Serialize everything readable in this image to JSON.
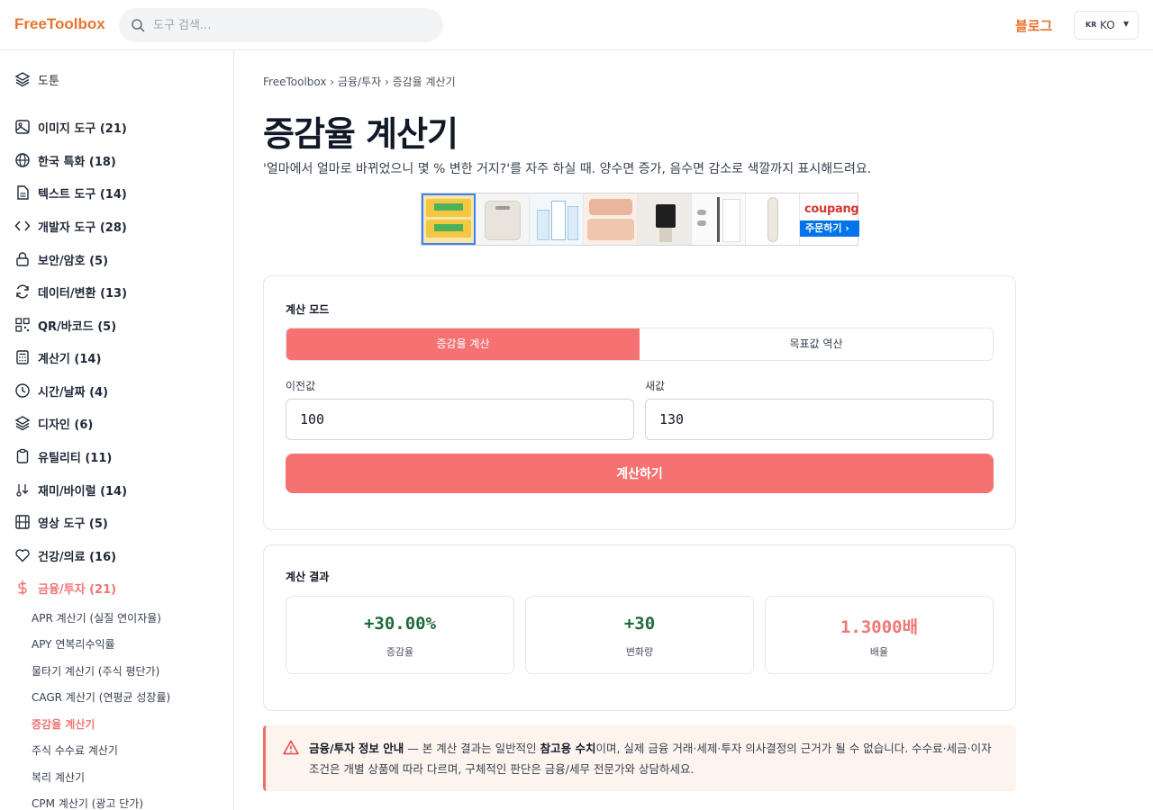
{
  "header": {
    "logo": "FreeToolbox",
    "search_placeholder": "도구 검색...",
    "blog_label": "블로그",
    "lang_flag": "KR",
    "lang_label": "KO"
  },
  "sidebar": {
    "top_item": "도툰",
    "categories": [
      {
        "label": "이미지 도구 (21)",
        "icon": "image-icon"
      },
      {
        "label": "한국 특화 (18)",
        "icon": "globe-icon"
      },
      {
        "label": "텍스트 도구 (14)",
        "icon": "document-icon"
      },
      {
        "label": "개발자 도구 (28)",
        "icon": "code-icon"
      },
      {
        "label": "보안/암호 (5)",
        "icon": "lock-icon"
      },
      {
        "label": "데이터/변환 (13)",
        "icon": "refresh-icon"
      },
      {
        "label": "QR/바코드 (5)",
        "icon": "qr-icon"
      },
      {
        "label": "계산기 (14)",
        "icon": "calculator-icon"
      },
      {
        "label": "시간/날짜 (4)",
        "icon": "clock-icon"
      },
      {
        "label": "디자인 (6)",
        "icon": "layers-icon"
      },
      {
        "label": "유틸리티 (11)",
        "icon": "clipboard-icon"
      },
      {
        "label": "재미/바이럴 (14)",
        "icon": "fun-icon"
      },
      {
        "label": "영상 도구 (5)",
        "icon": "film-icon"
      },
      {
        "label": "건강/의료 (16)",
        "icon": "heart-icon"
      },
      {
        "label": "금융/투자 (21)",
        "icon": "dollar-icon"
      }
    ],
    "sub_items": [
      "APR 계산기 (실질 연이자율)",
      "APY 연복리수익률",
      "물타기 계산기 (주식 평단가)",
      "CAGR 계산기 (연평균 성장률)",
      "증감율 계산기",
      "주식 수수료 계산기",
      "복리 계산기",
      "CPM 계산기 (광고 단가)"
    ]
  },
  "breadcrumb": [
    "FreeToolbox",
    "금융/투자",
    "증감율 계산기"
  ],
  "page": {
    "title": "증감율 계산기",
    "description": "'얼마에서 얼마로 바뀌었으니 몇 % 변한 거지?'를 자주 하실 때. 양수면 증가, 음수면 감소로 색깔까지 표시해드려요."
  },
  "ad": {
    "brand": "coupang",
    "cta": "주문하기 ›"
  },
  "calculator": {
    "mode_label": "계산 모드",
    "modes": [
      "증감율 계산",
      "목표값 역산"
    ],
    "prev_label": "이전값",
    "prev_value": "100",
    "new_label": "새값",
    "new_value": "130",
    "submit_label": "계산하기"
  },
  "result": {
    "label": "계산 결과",
    "items": [
      {
        "value": "+30.00%",
        "label": "증감율",
        "color": "#1e6b3a"
      },
      {
        "value": "+30",
        "label": "변화량",
        "color": "#1e6b3a"
      },
      {
        "value": "1.3000배",
        "label": "배율",
        "color": "#f07575"
      }
    ]
  },
  "notice": {
    "title": "금융/투자 정보 안내",
    "pre": " — 본 계산 결과는 일반적인 ",
    "bold": "참고용 수치",
    "post": "이며, 실제 금융 거래·세제·투자 의사결정의 근거가 될 수 없습니다. 수수료·세금·이자 조건은 개별 상품에 따라 다르며, 구체적인 판단은 금융/세무 전문가와 상담하세요."
  }
}
